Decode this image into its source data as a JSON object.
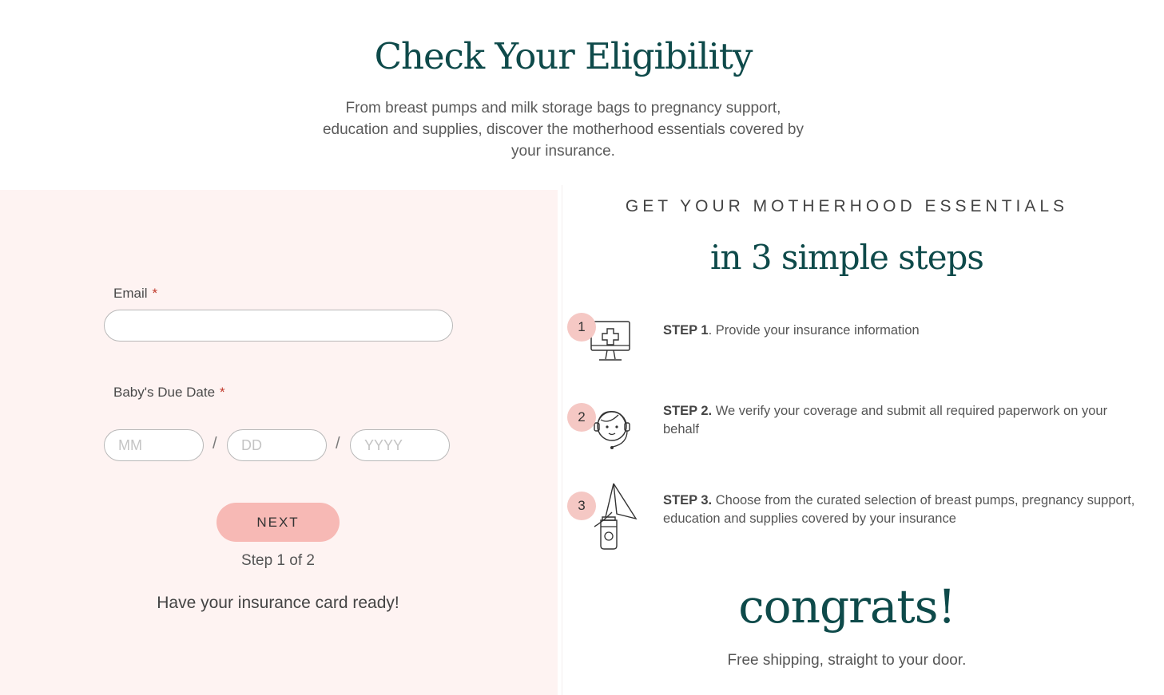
{
  "hero": {
    "title": "Check Your Eligibility",
    "subtitle": "From breast pumps and milk storage bags to pregnancy support, education and supplies, discover the motherhood essentials covered by your insurance."
  },
  "form": {
    "email_label": "Email",
    "required_marker": "*",
    "email_value": "",
    "due_date_label": "Baby's Due Date",
    "month_placeholder": "MM",
    "day_placeholder": "DD",
    "year_placeholder": "YYYY",
    "date_separator": "/",
    "next_label": "NEXT",
    "step_indicator": "Step 1 of 2",
    "card_note": "Have your insurance card ready!"
  },
  "essentials": {
    "kicker": "GET YOUR MOTHERHOOD ESSENTIALS",
    "heading": "in 3 simple steps",
    "steps": [
      {
        "number": "1",
        "label": "STEP 1",
        "text": ". Provide your insurance information",
        "icon": "monitor-medical-cross-icon"
      },
      {
        "number": "2",
        "label": "STEP 2.",
        "text": " We verify your coverage and submit all required paperwork on your behalf",
        "icon": "support-agent-headset-icon"
      },
      {
        "number": "3",
        "label": "STEP 3.",
        "text": " Choose from the curated selection of breast pumps, pregnancy support, education and supplies covered by your insurance",
        "icon": "breast-pump-icon"
      }
    ]
  },
  "closing": {
    "title": "congrats!",
    "subtitle": "Free shipping, straight to your door."
  },
  "colors": {
    "accent_teal": "#0e4a4a",
    "panel_pink": "#fef3f2",
    "button_pink": "#f7b9b5",
    "badge_pink": "#f5c8c4",
    "required_red": "#c0392b"
  }
}
